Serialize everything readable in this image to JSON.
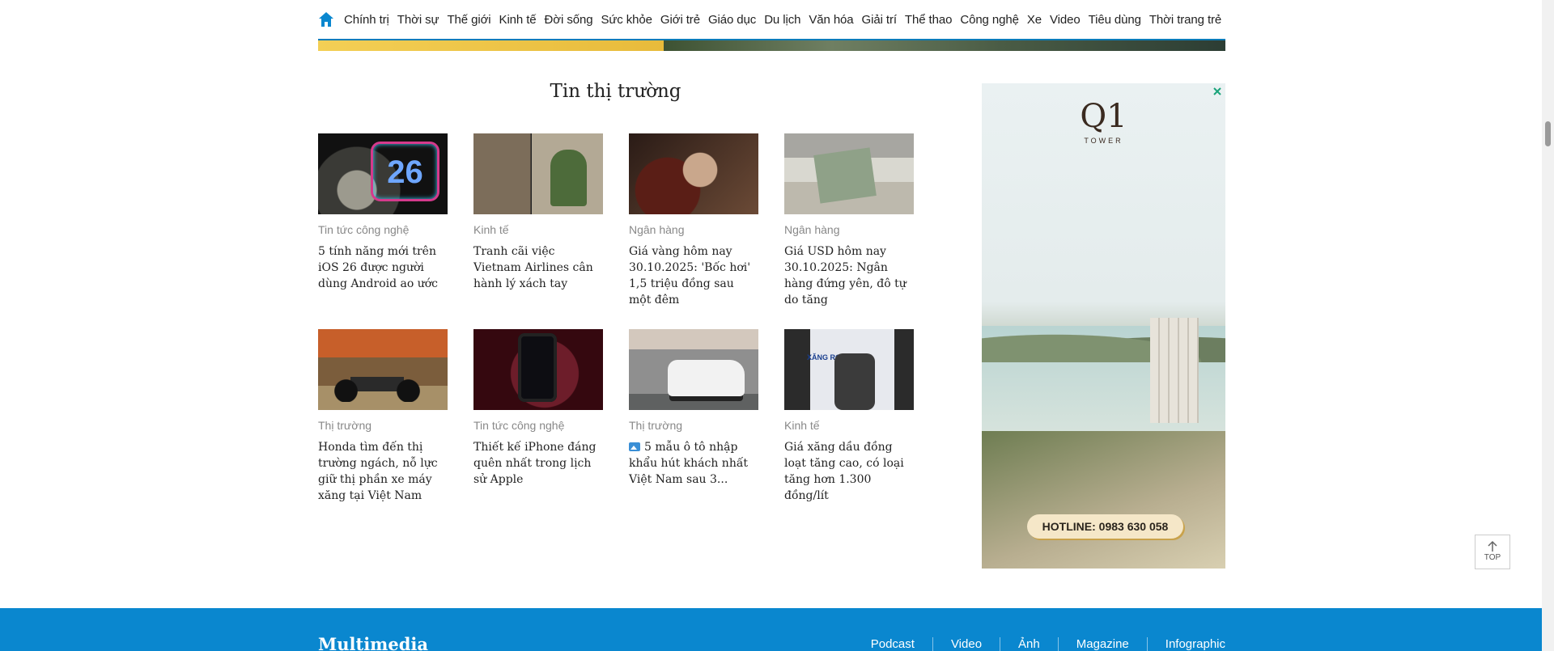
{
  "nav": {
    "items": [
      "Chính trị",
      "Thời sự",
      "Thế giới",
      "Kinh tế",
      "Đời sống",
      "Sức khỏe",
      "Giới trẻ",
      "Giáo dục",
      "Du lịch",
      "Văn hóa",
      "Giải trí",
      "Thể thao",
      "Công nghệ",
      "Xe",
      "Video",
      "Tiêu dùng",
      "Thời trang trẻ"
    ],
    "accent": "#0a87cf"
  },
  "section": {
    "title": "Tin thị trường"
  },
  "articles": [
    {
      "category": "Tin tức công nghệ",
      "title": "5 tính năng mới trên iOS 26 được người dùng Android ao ước",
      "thumb_text": "26"
    },
    {
      "category": "Kinh tế",
      "title": "Tranh cãi việc Vietnam Airlines cân hành lý xách tay"
    },
    {
      "category": "Ngân hàng",
      "title": "Giá vàng hôm nay 30.10.2025: 'Bốc hơi' 1,5 triệu đồng sau một đêm"
    },
    {
      "category": "Ngân hàng",
      "title": "Giá USD hôm nay 30.10.2025: Ngân hàng đứng yên, đô tự do tăng"
    },
    {
      "category": "Thị trường",
      "title": "Honda tìm đến thị trường ngách, nỗ lực giữ thị phần xe máy xăng tại Việt Nam"
    },
    {
      "category": "Tin tức công nghệ",
      "title": "Thiết kế iPhone đáng quên nhất trong lịch sử Apple"
    },
    {
      "category": "Thị trường",
      "title": "5 mẫu ô tô nhập khẩu hút khách nhất Việt Nam sau 3...",
      "has_photo_icon": true
    },
    {
      "category": "Kinh tế",
      "title": "Giá xăng dầu đồng loạt tăng cao, có loại tăng hơn 1.300 đồng/lít",
      "thumb_text": "XĂNG RON 95-III"
    }
  ],
  "ad": {
    "logo": "Q1",
    "logo_sub": "TOWER",
    "hotline": "HOTLINE: 0983 630 058"
  },
  "totop": {
    "label": "TOP"
  },
  "footer": {
    "title": "Multimedia",
    "links": [
      "Podcast",
      "Video",
      "Ảnh",
      "Magazine",
      "Infographic"
    ]
  }
}
